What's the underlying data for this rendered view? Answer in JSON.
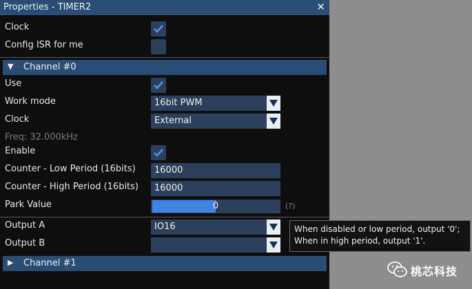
{
  "window": {
    "title": "Properties - TIMER2"
  },
  "rows": {
    "clock_enable": {
      "label": "Clock",
      "checked": true
    },
    "config_isr": {
      "label": "Config ISR for me",
      "checked": false
    }
  },
  "channel0": {
    "title": "Channel #0",
    "expanded": true,
    "use": {
      "label": "Use",
      "checked": true
    },
    "work_mode": {
      "label": "Work mode",
      "value": "16bit PWM"
    },
    "clock": {
      "label": "Clock",
      "value": "External"
    },
    "freq": {
      "text": "Freq: 32.000kHz"
    },
    "enable": {
      "label": "Enable",
      "checked": true
    },
    "low_period": {
      "label": "Counter - Low Period (16bits)",
      "value": "16000"
    },
    "high_period": {
      "label": "Counter - High Period (16bits)",
      "value": "16000"
    },
    "park_value": {
      "label": "Park Value",
      "value": "0",
      "fill_fraction": 0.5,
      "help": "(?)"
    },
    "output_a": {
      "label": "Output A",
      "value": "IO16"
    },
    "output_b": {
      "label": "Output B",
      "value": ""
    }
  },
  "channel1": {
    "title": "Channel #1",
    "expanded": false
  },
  "tooltip": {
    "line1": "When disabled or low period, output '0';",
    "line2": "When in high period, output '1'."
  },
  "watermark": {
    "text": "桃芯科技"
  },
  "colors": {
    "accent": "#2a4d75",
    "field": "#2c3f5b",
    "slider_fill": "#3f84e0",
    "check": "#4f95ec"
  }
}
